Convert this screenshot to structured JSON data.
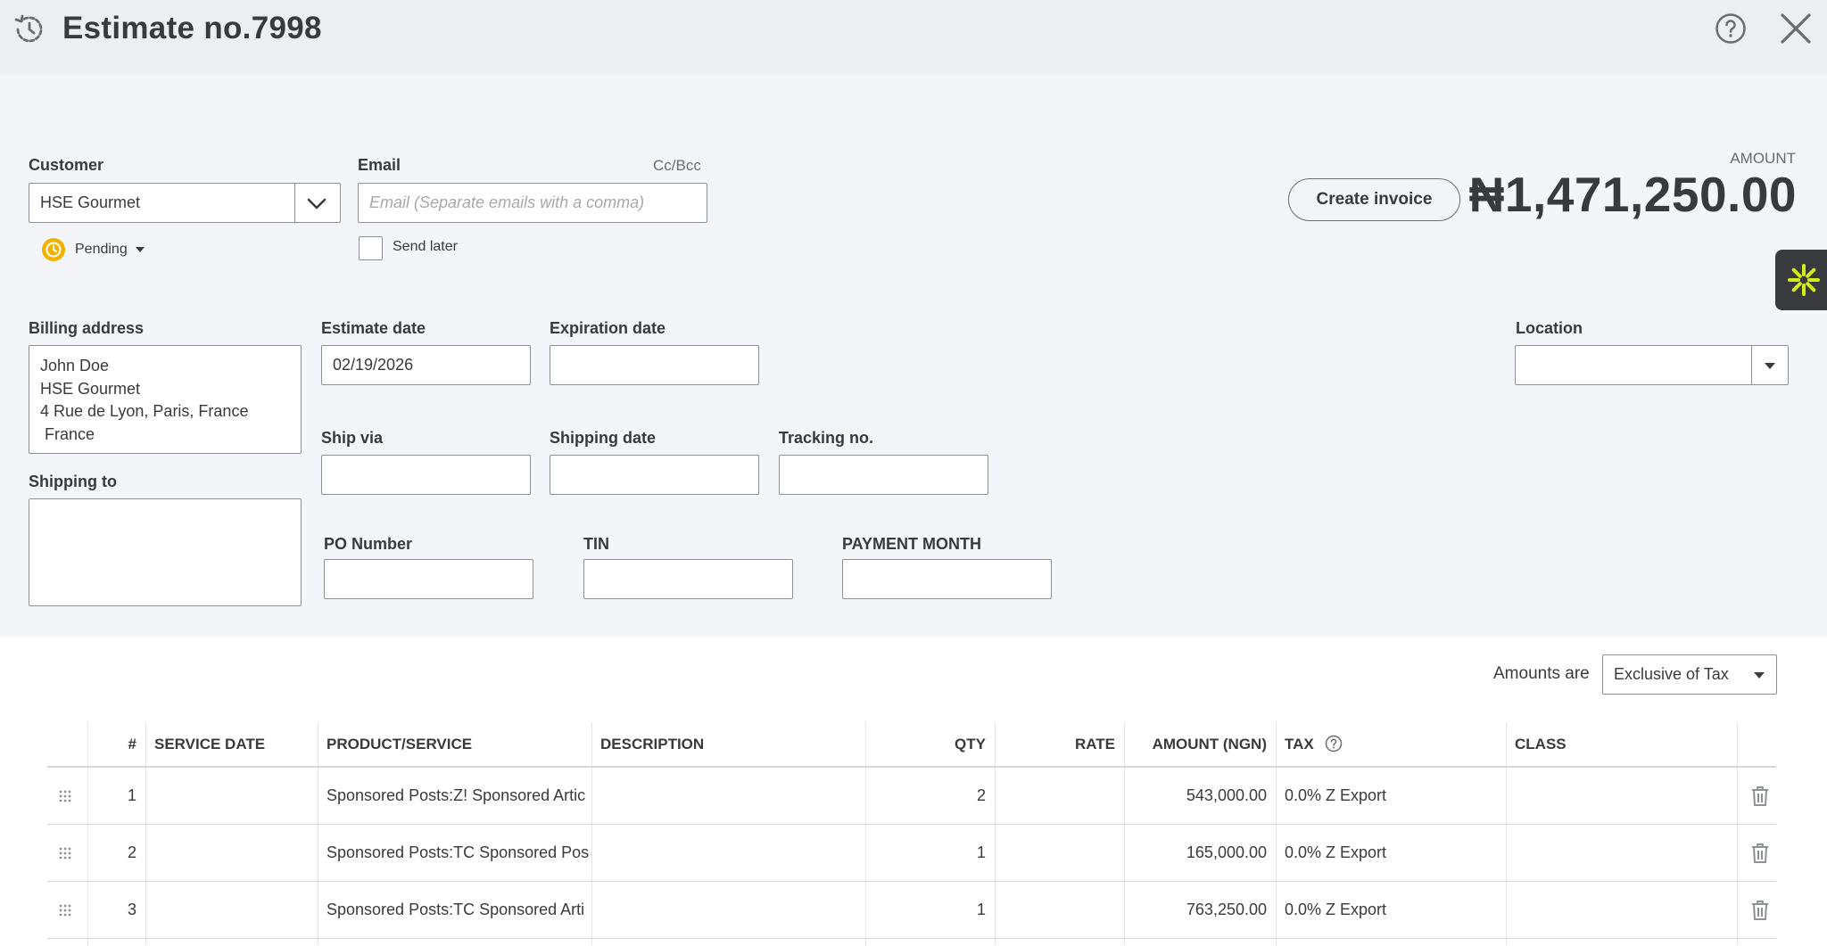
{
  "header": {
    "title": "Estimate no.7998"
  },
  "customer": {
    "label": "Customer",
    "value": "HSE Gourmet",
    "status": "Pending"
  },
  "email": {
    "label": "Email",
    "cc_bcc": "Cc/Bcc",
    "placeholder": "Email (Separate emails with a comma)",
    "send_later": "Send later"
  },
  "actions": {
    "create_invoice": "Create invoice"
  },
  "amount": {
    "label": "AMOUNT",
    "value": "₦1,471,250.00"
  },
  "billing": {
    "label": "Billing address",
    "address": "John Doe\nHSE Gourmet\n4 Rue de Lyon, Paris, France\n France"
  },
  "shipping_to": {
    "label": "Shipping to",
    "value": ""
  },
  "fields": {
    "estimate_date": {
      "label": "Estimate date",
      "value": "02/19/2026"
    },
    "expiration_date": {
      "label": "Expiration date",
      "value": ""
    },
    "ship_via": {
      "label": "Ship via",
      "value": ""
    },
    "shipping_date": {
      "label": "Shipping date",
      "value": ""
    },
    "tracking_no": {
      "label": "Tracking no.",
      "value": ""
    },
    "po_number": {
      "label": "PO Number",
      "value": ""
    },
    "tin": {
      "label": "TIN",
      "value": ""
    },
    "payment_month": {
      "label": "PAYMENT MONTH",
      "value": ""
    },
    "location": {
      "label": "Location",
      "value": ""
    }
  },
  "amounts_are": {
    "label": "Amounts are",
    "value": "Exclusive of Tax"
  },
  "table": {
    "headers": {
      "num": "#",
      "service_date": "SERVICE DATE",
      "product": "PRODUCT/SERVICE",
      "description": "DESCRIPTION",
      "qty": "QTY",
      "rate": "RATE",
      "amount": "AMOUNT (NGN)",
      "tax": "TAX",
      "class": "CLASS"
    },
    "rows": [
      {
        "num": "1",
        "service_date": "",
        "product": "Sponsored Posts:Z! Sponsored Artic",
        "description": "",
        "qty": "2",
        "rate": "",
        "amount": "543,000.00",
        "tax": "0.0% Z Export",
        "class": ""
      },
      {
        "num": "2",
        "service_date": "",
        "product": "Sponsored Posts:TC Sponsored Pos",
        "description": "",
        "qty": "1",
        "rate": "",
        "amount": "165,000.00",
        "tax": "0.0% Z Export",
        "class": ""
      },
      {
        "num": "3",
        "service_date": "",
        "product": "Sponsored Posts:TC Sponsored Arti",
        "description": "",
        "qty": "1",
        "rate": "",
        "amount": "763,250.00",
        "tax": "0.0% Z Export",
        "class": ""
      }
    ]
  },
  "colors": {
    "header_bg": "#eceef1",
    "page_bg": "#f4f5f8",
    "pending_accent": "#f2b200",
    "widget_bg": "#393a3d",
    "widget_accent": "#d4ec1a"
  }
}
